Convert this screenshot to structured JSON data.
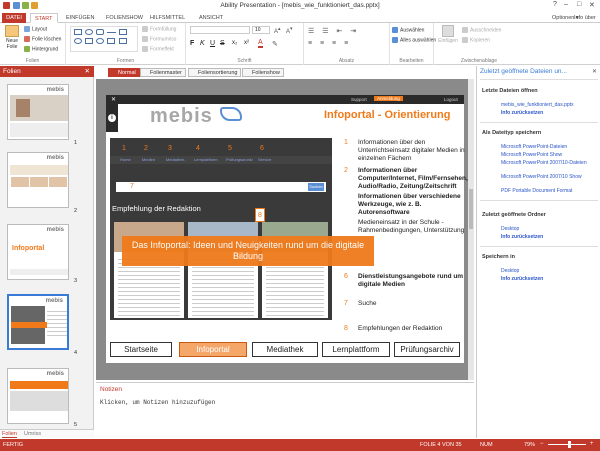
{
  "window": {
    "title": "Ability Presentation - [mebis_wie_funktioniert_das.pptx]"
  },
  "menu": {
    "tabs": [
      "DATEI",
      "START",
      "EINFÜGEN",
      "FOLIENSHOW",
      "HILFSMITTEL",
      "ANSICHT"
    ],
    "options": "Optionen",
    "info": "Info über"
  },
  "ribbon": {
    "folien": {
      "label": "Folien",
      "neue_folie": "Neue Folie",
      "layout": "Layout",
      "folie_loeschen": "Folie löschen",
      "hintergrund": "Hintergrund"
    },
    "formen": {
      "label": "Formen",
      "formfuellung": "Formfüllung",
      "formumriss": "Formumriss",
      "formeffekt": "Formeffekt"
    },
    "schrift": {
      "label": "Schrift",
      "font_size": "10"
    },
    "absatz": {
      "label": "Absatz"
    },
    "bearbeiten": {
      "label": "Bearbeiten",
      "auswaehlen": "Auswählen",
      "alles_auswaehlen": "Alles auswählen"
    },
    "zwischenablage": {
      "label": "Zwischenablage",
      "einfuegen": "Einfügen",
      "ausschneiden": "Ausschneiden",
      "kopieren": "Kopieren"
    }
  },
  "left_pane": {
    "title": "Folien",
    "thumbs": [
      {
        "num": "1",
        "logo": "mebis"
      },
      {
        "num": "2",
        "logo": "mebis"
      },
      {
        "num": "3",
        "logo": "mebis",
        "label": "Infoportal"
      },
      {
        "num": "4",
        "logo": "mebis"
      },
      {
        "num": "5",
        "logo": "mebis"
      }
    ],
    "bottom_tabs": [
      "Folien",
      "Umriss"
    ]
  },
  "view_tabs": [
    "Normal",
    "Folienmaster",
    "Foliensortierung",
    "Folienshow"
  ],
  "slide": {
    "logo": "mebis",
    "title": "Infoportal - Orientierung",
    "top_links": [
      "Support",
      "Anmeldung",
      "Logout"
    ],
    "screenshot": {
      "nav_numbers": [
        "1",
        "2",
        "3",
        "4",
        "5",
        "6"
      ],
      "nav_items": [
        "Home",
        "Medien",
        "Mediathek",
        "Lernplattform",
        "Prüfungsarchiv",
        "Service"
      ],
      "search_num": "7",
      "search_button": "Suchen",
      "tile_num": "8",
      "heading": "Empfehlung der Redaktion"
    },
    "overlay": "Das Infoportal: Ideen und Neuigkeiten rund um die digitale Bildung",
    "items": [
      {
        "num": "1",
        "text": "Informationen über den Unterrichtseinsatz digitaler Medien in einzelnen Fächern",
        "bold": false
      },
      {
        "num": "2",
        "text": "Informationen über Computer/Internet, Film/Fernsehen, Audio/Radio, Zeitung/Zeitschrift",
        "bold": true
      },
      {
        "num": "",
        "text": "Informationen über verschiedene Werkzeuge, wie z. B. Autorensoftware",
        "bold": true
      },
      {
        "num": "",
        "text": "Medieneinsatz in der Schule - Rahmenbedingungen, Unterstützung",
        "bold": false
      },
      {
        "num": "6",
        "text": "Dienstleistungsangebote rund um digitale Medien",
        "bold": true
      },
      {
        "num": "7",
        "text": "Suche",
        "bold": false
      },
      {
        "num": "8",
        "text": "Empfehlungen der Redaktion",
        "bold": false
      }
    ],
    "nav_buttons": [
      "Startseite",
      "Infoportal",
      "Mediathek",
      "Lernplattform",
      "Prüfungsarchiv"
    ]
  },
  "notes": {
    "title": "Notizen",
    "placeholder": "Klicken, um Notizen hinzuzufügen"
  },
  "right_pane": {
    "title": "Zuletzt geöffnete Dateien un...",
    "recent_files_title": "Letzte Dateien öffnen",
    "recent_files": [
      "mebis_wie_funktioniert_das.pptx"
    ],
    "recent_files_reset": "Info zurücksetzen",
    "save_as_title": "Als Dateityp speichern",
    "save_as": [
      "Microsoft PowerPoint-Dateien",
      "Microsoft PowerPoint Show",
      "Microsoft PowerPoint 2007/10-Dateien",
      "Microsoft PowerPoint 2007/10 Show",
      "PDF Portable Document Format"
    ],
    "recent_folders_title": "Zuletzt geöffnete Ordner",
    "recent_folders": [
      "Desktop"
    ],
    "recent_folders_reset": "Info zurücksetzen",
    "save_in_title": "Speichern in",
    "save_in": [
      "Desktop"
    ],
    "save_in_reset": "Info zurücksetzen"
  },
  "status": {
    "left": "FERTIG",
    "slide_info": "FOLIE 4 VON 35",
    "num": "NUM",
    "zoom": "79%"
  },
  "colors": {
    "accent": "#c0392b",
    "slide_orange": "#f07a1a",
    "link": "#2a55c8"
  }
}
